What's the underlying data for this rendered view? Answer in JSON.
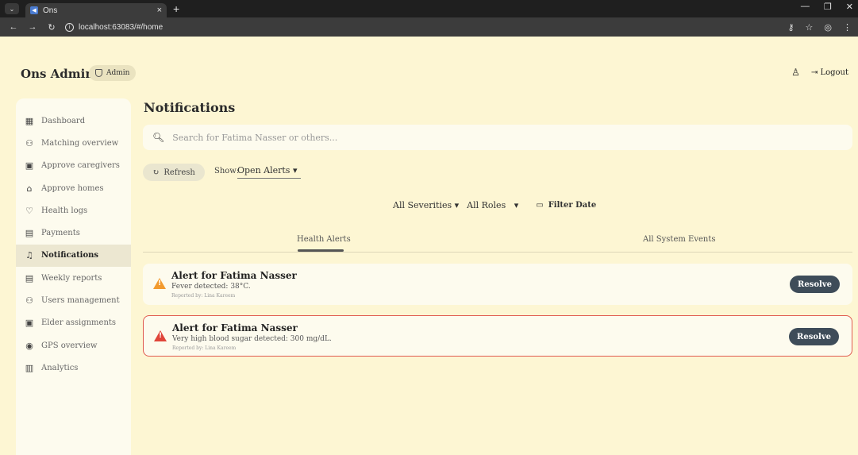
{
  "browser": {
    "tab_title": "Ons",
    "url": "localhost:63083/#/home"
  },
  "header": {
    "app_title": "Ons Admin",
    "role_badge": "Admin",
    "logout_label": "Logout"
  },
  "sidebar": {
    "items": [
      {
        "label": "Dashboard",
        "icon": "dashboard-icon"
      },
      {
        "label": "Matching overview",
        "icon": "people-icon"
      },
      {
        "label": "Approve caregivers",
        "icon": "badge-icon"
      },
      {
        "label": "Approve homes",
        "icon": "home-icon"
      },
      {
        "label": "Health logs",
        "icon": "heart-icon"
      },
      {
        "label": "Payments",
        "icon": "payments-icon"
      },
      {
        "label": "Notifications",
        "icon": "bell-icon",
        "active": true
      },
      {
        "label": "Weekly reports",
        "icon": "report-icon"
      },
      {
        "label": "Users management",
        "icon": "users-icon"
      },
      {
        "label": "Elder assignments",
        "icon": "assign-icon"
      },
      {
        "label": "GPS overview",
        "icon": "pin-icon"
      },
      {
        "label": "Analytics",
        "icon": "analytics-icon"
      }
    ]
  },
  "main": {
    "title": "Notifications",
    "search_placeholder": "Search for Fatima Nasser or others...",
    "refresh_label": "Refresh",
    "show_label": "Show:",
    "show_value": "Open Alerts",
    "severity_filter": "All Severities",
    "roles_filter": "All Roles",
    "filter_date_label": "Filter Date",
    "tabs": [
      "Health Alerts",
      "All System Events"
    ],
    "alerts": [
      {
        "title": "Alert for Fatima Nasser",
        "message": "Fever detected: 38°C.",
        "reported_by": "Reported by: Lina Kareem",
        "severity": "warning",
        "action": "Resolve"
      },
      {
        "title": "Alert for Fatima Nasser",
        "message": "Very high blood sugar detected: 300 mg/dL.",
        "reported_by": "Reported by: Lina Kareem",
        "severity": "critical",
        "action": "Resolve"
      }
    ]
  },
  "colors": {
    "background": "#fdf6d3",
    "warning": "#f29a2e",
    "critical": "#e0453a",
    "button_dark": "#3e4c59"
  }
}
